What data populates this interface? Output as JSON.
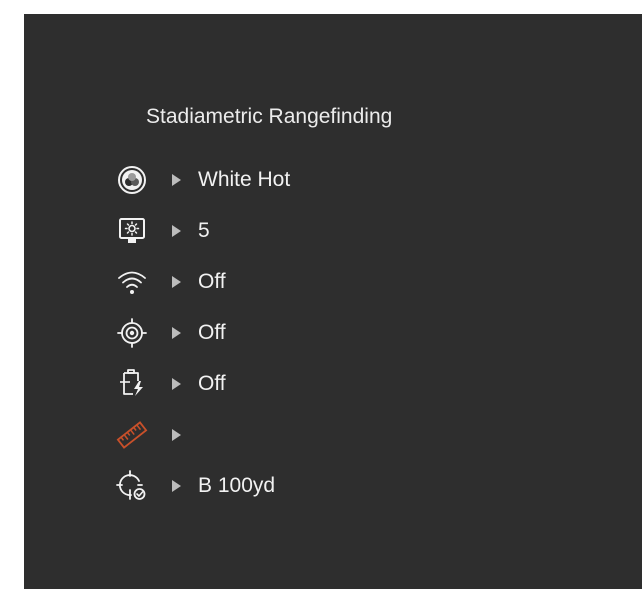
{
  "menu": {
    "title": "Stadiametric Rangefinding",
    "accent_color": "#c8502a",
    "text_color": "#f2f2f2",
    "items": [
      {
        "icon": "palette-icon",
        "value": "White Hot",
        "active": false
      },
      {
        "icon": "brightness-icon",
        "value": "5",
        "active": false
      },
      {
        "icon": "wifi-icon",
        "value": "Off",
        "active": false
      },
      {
        "icon": "target-icon",
        "value": "Off",
        "active": false
      },
      {
        "icon": "battery-swap-icon",
        "value": "Off",
        "active": false
      },
      {
        "icon": "ruler-icon",
        "value": "",
        "active": true
      },
      {
        "icon": "crosshair-check-icon",
        "value": "B 100yd",
        "active": false
      }
    ]
  }
}
